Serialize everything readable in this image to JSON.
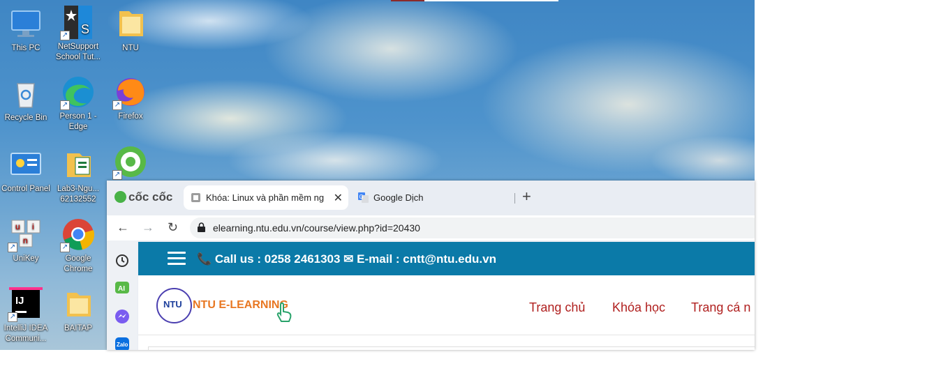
{
  "desktop": {
    "icons": [
      {
        "label": "This PC"
      },
      {
        "label": "NetSupport School Tut..."
      },
      {
        "label": "NTU"
      },
      {
        "label": "Recycle Bin"
      },
      {
        "label": "Person 1 - Edge"
      },
      {
        "label": "Firefox"
      },
      {
        "label": "Control Panel"
      },
      {
        "label": "Lab3-Ngu... 62132552"
      },
      {
        "label": ""
      },
      {
        "label": "UniKey"
      },
      {
        "label": "Google Chrome"
      },
      {
        "label": "IntelliJ IDEA Communi..."
      },
      {
        "label": "BAITAP"
      }
    ]
  },
  "browser": {
    "brand": "cốc cốc",
    "tabs": [
      {
        "title": "Khóa: Linux và phần mềm ng",
        "active": true
      },
      {
        "title": "Google Dịch",
        "active": false
      }
    ],
    "url": "elearning.ntu.edu.vn/course/view.php?id=20430",
    "sidebar_icons": [
      "history-icon",
      "ai-icon",
      "messenger-icon",
      "zalo-icon"
    ],
    "ai_label": "AI",
    "zalo_label": "Zalo"
  },
  "site": {
    "contact": "📞 Call us : 0258 2461303 ✉ E-mail : cntt@ntu.edu.vn",
    "logo_seal": "NTU",
    "logo_name": "NTU E-LEARNING",
    "menu": [
      "Trang chủ",
      "Khóa học",
      "Trang cá n"
    ]
  },
  "colors": {
    "header_blue": "#0b7aa8",
    "menu_red": "#b0201f",
    "brand_orange": "#e87722"
  }
}
